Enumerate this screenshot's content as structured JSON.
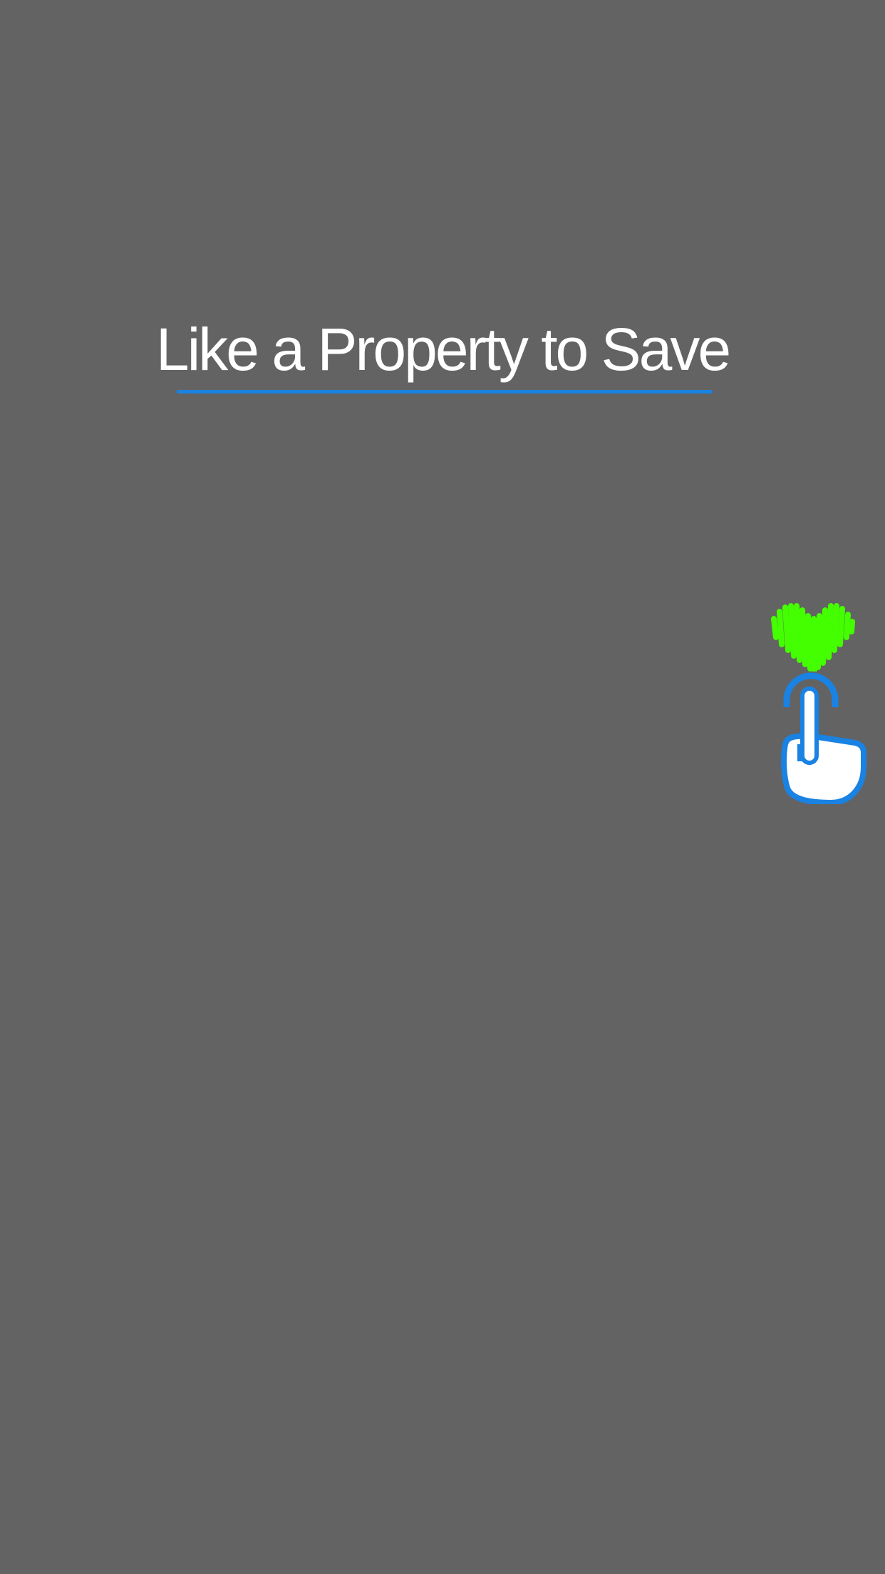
{
  "tutorial": {
    "title": "Like a Property to Save"
  },
  "colors": {
    "overlay_background": "#636363",
    "title_text": "#ffffff",
    "accent_blue": "#1a82e2",
    "heart_green": "#44ff00"
  },
  "icons": {
    "heart": "heart-icon",
    "tap_hand": "tap-hand-icon"
  }
}
